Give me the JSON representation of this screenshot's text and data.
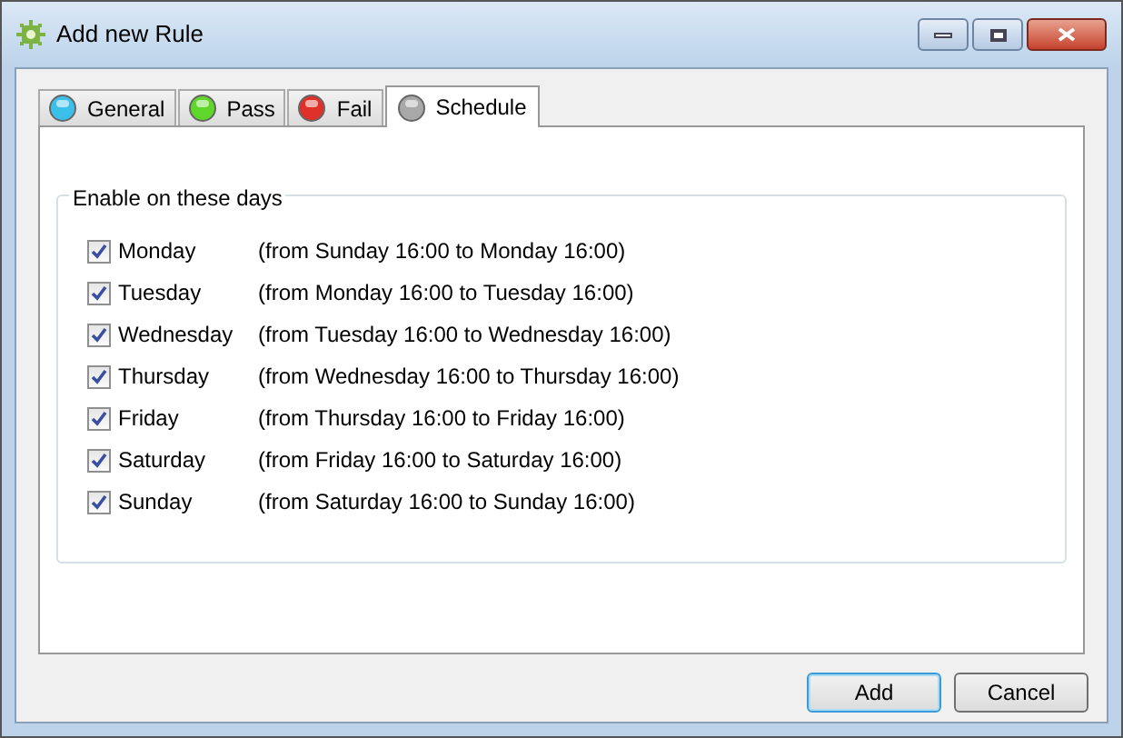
{
  "window": {
    "title": "Add new Rule"
  },
  "tabs": [
    {
      "label": "General",
      "selected": false,
      "color": "#3cc0ea"
    },
    {
      "label": "Pass",
      "selected": false,
      "color": "#5ed62a"
    },
    {
      "label": "Fail",
      "selected": false,
      "color": "#e0302a"
    },
    {
      "label": "Schedule",
      "selected": true,
      "color": "#a8a8a8"
    }
  ],
  "group": {
    "title": "Enable on these days",
    "days": [
      {
        "label": "Monday",
        "checked": true,
        "range": "(from Sunday 16:00 to Monday 16:00)"
      },
      {
        "label": "Tuesday",
        "checked": true,
        "range": "(from Monday 16:00 to Tuesday 16:00)"
      },
      {
        "label": "Wednesday",
        "checked": true,
        "range": "(from Tuesday 16:00 to Wednesday 16:00)"
      },
      {
        "label": "Thursday",
        "checked": true,
        "range": "(from Wednesday 16:00 to Thursday 16:00)"
      },
      {
        "label": "Friday",
        "checked": true,
        "range": "(from Thursday 16:00 to Friday 16:00)"
      },
      {
        "label": "Saturday",
        "checked": true,
        "range": "(from Friday 16:00 to Saturday 16:00)"
      },
      {
        "label": "Sunday",
        "checked": true,
        "range": "(from Saturday 16:00 to Sunday 16:00)"
      }
    ]
  },
  "buttons": [
    {
      "label": "Add",
      "selected": true
    },
    {
      "label": "Cancel",
      "selected": false
    }
  ]
}
